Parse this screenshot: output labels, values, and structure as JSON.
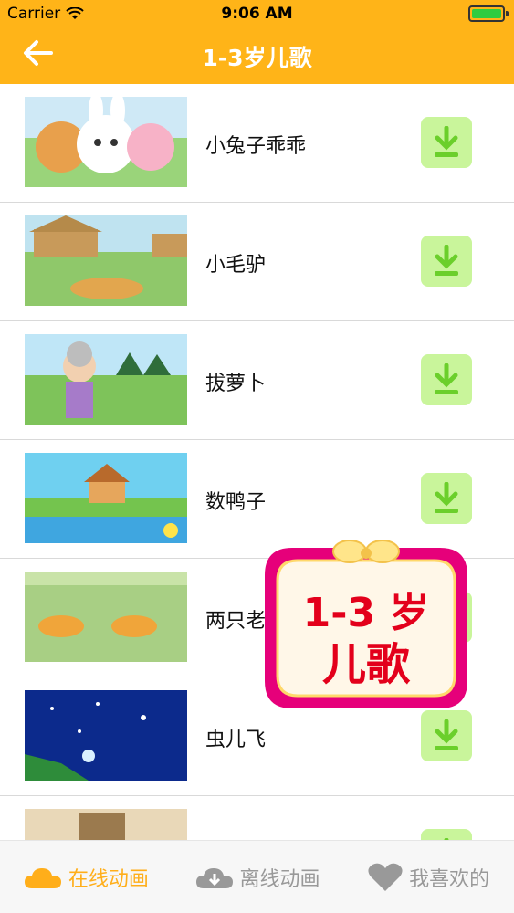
{
  "status_bar": {
    "carrier": "Carrier",
    "time": "9:06 AM"
  },
  "nav": {
    "title": "1-3岁儿歌",
    "back_icon": "arrow-left-icon"
  },
  "songs": [
    {
      "title": "小兔子乖乖",
      "thumb": "three-animal-cartoon"
    },
    {
      "title": "小毛驴",
      "thumb": "donkey-village"
    },
    {
      "title": "拔萝卜",
      "thumb": "grandma-garden"
    },
    {
      "title": "数鸭子",
      "thumb": "house-river"
    },
    {
      "title": "两只老虎",
      "thumb": "two-tigers-field"
    },
    {
      "title": "虫儿飞",
      "thumb": "night-sky-stars"
    },
    {
      "title": "",
      "thumb": "partial-cartoon"
    }
  ],
  "overlay_badge": {
    "line1": "1-3 岁",
    "line2": "儿歌"
  },
  "tabbar": [
    {
      "label": "在线动画",
      "icon": "cloud-icon",
      "active": true
    },
    {
      "label": "离线动画",
      "icon": "cloud-download-icon",
      "active": false
    },
    {
      "label": "我喜欢的",
      "icon": "heart-icon",
      "active": false
    }
  ],
  "colors": {
    "header": "#ffb418",
    "download_bg": "#c9f59b",
    "download_icon": "#6bcf2b",
    "active_tab": "#ffae1a"
  }
}
